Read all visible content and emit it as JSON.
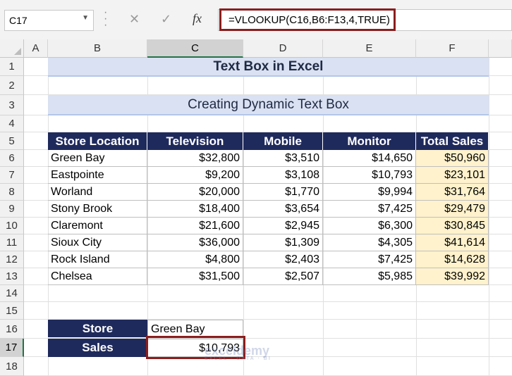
{
  "formula_bar": {
    "name_box": "C17",
    "cancel_icon": "✕",
    "enter_icon": "✓",
    "fx_label": "fx",
    "formula": "=VLOOKUP(C16,B6:F13,4,TRUE)"
  },
  "columns": [
    "A",
    "B",
    "C",
    "D",
    "E",
    "F"
  ],
  "active_column": "C",
  "rows": [
    "1",
    "2",
    "3",
    "4",
    "5",
    "6",
    "7",
    "8",
    "9",
    "10",
    "11",
    "12",
    "13",
    "14",
    "15",
    "16",
    "17",
    "18"
  ],
  "active_row": "17",
  "title": "Text Box in Excel",
  "subtitle": "Creating Dynamic Text Box",
  "table": {
    "headers": [
      "Store Location",
      "Television",
      "Mobile",
      "Monitor",
      "Total Sales"
    ],
    "rows": [
      [
        "Green Bay",
        "$32,800",
        "$3,510",
        "$14,650",
        "$50,960"
      ],
      [
        "Eastpointe",
        "$9,200",
        "$3,108",
        "$10,793",
        "$23,101"
      ],
      [
        "Worland",
        "$20,000",
        "$1,770",
        "$9,994",
        "$31,764"
      ],
      [
        "Stony Brook",
        "$18,400",
        "$3,654",
        "$7,425",
        "$29,479"
      ],
      [
        "Claremont",
        "$21,600",
        "$2,945",
        "$6,300",
        "$30,845"
      ],
      [
        "Sioux City",
        "$36,000",
        "$1,309",
        "$4,305",
        "$41,614"
      ],
      [
        "Rock Island",
        "$4,800",
        "$2,403",
        "$7,425",
        "$14,628"
      ],
      [
        "Chelsea",
        "$31,500",
        "$2,507",
        "$5,985",
        "$39,992"
      ]
    ]
  },
  "lookup": {
    "store_label": "Store",
    "store_value": "Green Bay",
    "sales_label": "Sales",
    "sales_value": "$10,793"
  },
  "watermark": {
    "name": "exceldemy",
    "tagline": "EXCEL · DATA · BI"
  },
  "colors": {
    "header_navy": "#1f2a5c",
    "title_fill": "#d9e1f2",
    "total_fill": "#fff2cc",
    "highlight_border": "#8b1e1e",
    "excel_green": "#217346"
  }
}
